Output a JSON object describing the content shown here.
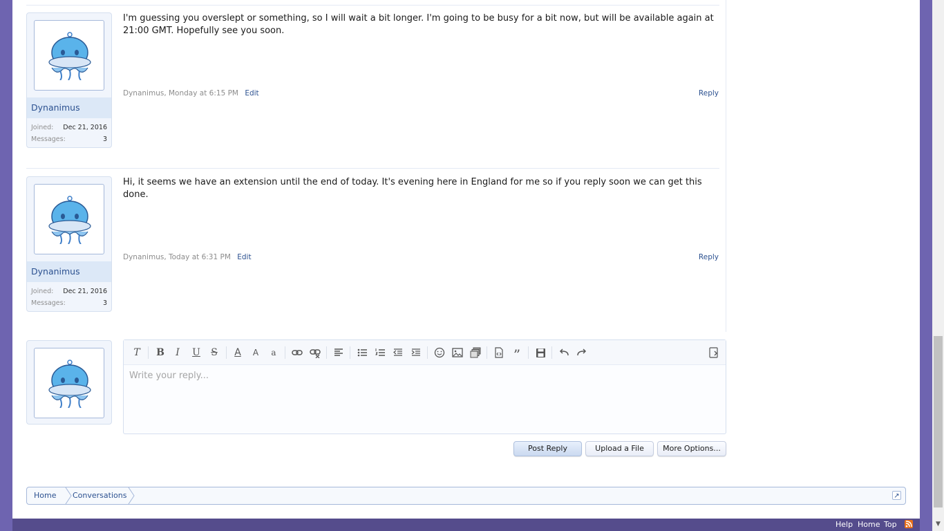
{
  "messages": [
    {
      "text": "I'm guessing you overslept or something, so I will wait a bit longer. I'm going to be busy for a bit now, but will be available again at 21:00 GMT. Hopefully see you soon.",
      "meta": "Dynanimus, Monday at 6:15 PM",
      "edit_label": "Edit",
      "reply_label": "Reply",
      "user": {
        "name": "Dynanimus",
        "joined_label": "Joined:",
        "joined_value": "Dec 21, 2016",
        "messages_label": "Messages:",
        "messages_value": "3"
      }
    },
    {
      "text": "Hi, it seems we have an extension until the end of today. It's evening here in England for me so if you reply soon we can get this done.",
      "meta": "Dynanimus, Today at 6:31 PM",
      "edit_label": "Edit",
      "reply_label": "Reply",
      "user": {
        "name": "Dynanimus",
        "joined_label": "Joined:",
        "joined_value": "Dec 21, 2016",
        "messages_label": "Messages:",
        "messages_value": "3"
      }
    }
  ],
  "editor": {
    "placeholder": "Write your reply...",
    "toolbar": {
      "remove_format": "T",
      "bold": "B",
      "italic": "I",
      "underline": "U",
      "strike": "S",
      "text_color": "A",
      "font_size": "A",
      "font_family": "a"
    }
  },
  "buttons": {
    "post_reply": "Post Reply",
    "upload_file": "Upload a File",
    "more_options": "More Options..."
  },
  "breadcrumb": [
    "Home",
    "Conversations"
  ],
  "footer_links": [
    "Help",
    "Home",
    "Top"
  ],
  "icons": {
    "avatar": "jellyfish-avatar-icon",
    "jump": "jump-to-icon",
    "rss": "rss-icon"
  },
  "colors": {
    "background": "#6e64b0",
    "link": "#2c5190",
    "footer": "#554c8c"
  }
}
